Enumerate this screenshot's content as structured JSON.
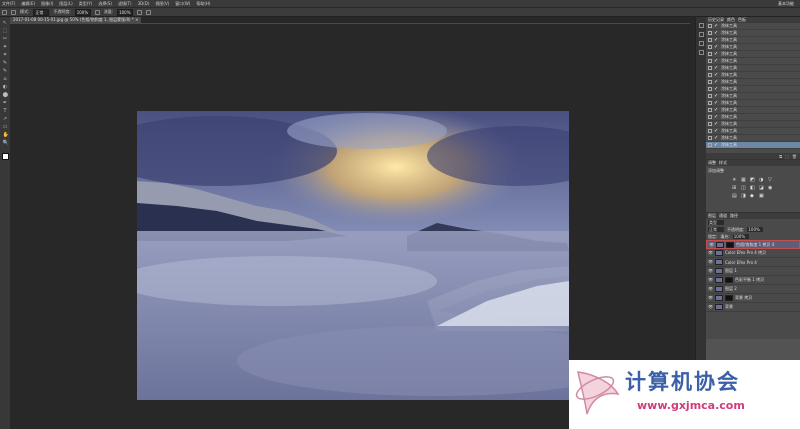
{
  "menubar": {
    "items": [
      "文件(F)",
      "编辑(E)",
      "图像(I)",
      "图层(L)",
      "类型(Y)",
      "选择(S)",
      "滤镜(T)",
      "3D(D)",
      "视图(V)",
      "窗口(W)",
      "帮助(H)"
    ],
    "workspace": "基本功能"
  },
  "options": {
    "mode_label": "模式:",
    "mode_value": "正常",
    "opacity_label": "不透明度:",
    "opacity_value": "100%",
    "flow_label": "流量:",
    "flow_value": "100%"
  },
  "document": {
    "tab_title": "2017-01-08 00-15-01.jpg @ 50% (色相/饱和度 1, 图层蒙版/8) *",
    "close": "×"
  },
  "tools": [
    "↖",
    "⬚",
    "✂",
    "✦",
    "⌗",
    "✎",
    "✎",
    "⌂",
    "◐",
    "⬤",
    "✒",
    "T",
    "↗",
    "▭",
    "✋",
    "🔍"
  ],
  "history": {
    "tabs": [
      "历史记录",
      "颜色",
      "色板"
    ],
    "items": [
      {
        "label": "涂抹工具"
      },
      {
        "label": "涂抹工具"
      },
      {
        "label": "涂抹工具"
      },
      {
        "label": "涂抹工具"
      },
      {
        "label": "涂抹工具"
      },
      {
        "label": "涂抹工具"
      },
      {
        "label": "涂抹工具"
      },
      {
        "label": "涂抹工具"
      },
      {
        "label": "涂抹工具"
      },
      {
        "label": "涂抹工具"
      },
      {
        "label": "涂抹工具"
      },
      {
        "label": "涂抹工具"
      },
      {
        "label": "涂抹工具"
      },
      {
        "label": "涂抹工具"
      },
      {
        "label": "涂抹工具"
      },
      {
        "label": "涂抹工具"
      },
      {
        "label": "涂抹工具"
      },
      {
        "label": "涂抹工具"
      }
    ],
    "footer": [
      "⧉",
      "⬚",
      "🗑"
    ]
  },
  "adjustments": {
    "tabs": [
      "调整",
      "样式"
    ],
    "add_label": "添加调整",
    "icons": [
      "☀",
      "▦",
      "◩",
      "◑",
      "▽",
      "⊞",
      "◫",
      "◧",
      "◪",
      "◉",
      "▤",
      "◨",
      "◆",
      "▣"
    ]
  },
  "layers": {
    "tabs": [
      "图层",
      "通道",
      "路径"
    ],
    "kind_label": "类型",
    "blend_value": "正常",
    "opacity_label": "不透明度:",
    "opacity_value": "100%",
    "lock_label": "锁定:",
    "fill_label": "填充:",
    "fill_value": "100%",
    "items": [
      {
        "name": "色相/饱和度 1 拷贝 4",
        "type": "adjust"
      },
      {
        "name": "Color Efex Pro 4 拷贝",
        "type": "image"
      },
      {
        "name": "Color Efex Pro 4",
        "type": "image"
      },
      {
        "name": "图层 1",
        "type": "image"
      },
      {
        "name": "色彩平衡 1 拷贝",
        "type": "adjust"
      },
      {
        "name": "图层 2",
        "type": "image"
      },
      {
        "name": "背景 拷贝",
        "type": "adjust"
      },
      {
        "name": "背景",
        "type": "image"
      }
    ]
  },
  "watermark": {
    "title": "计算机协会",
    "url": "www.gxjmca.com"
  },
  "colors": {
    "app_bg": "#282828",
    "panel_bg": "#535353",
    "selection": "#6d87a6",
    "watermark_blue": "#3b5fa8",
    "watermark_pink": "#d03b7a"
  }
}
